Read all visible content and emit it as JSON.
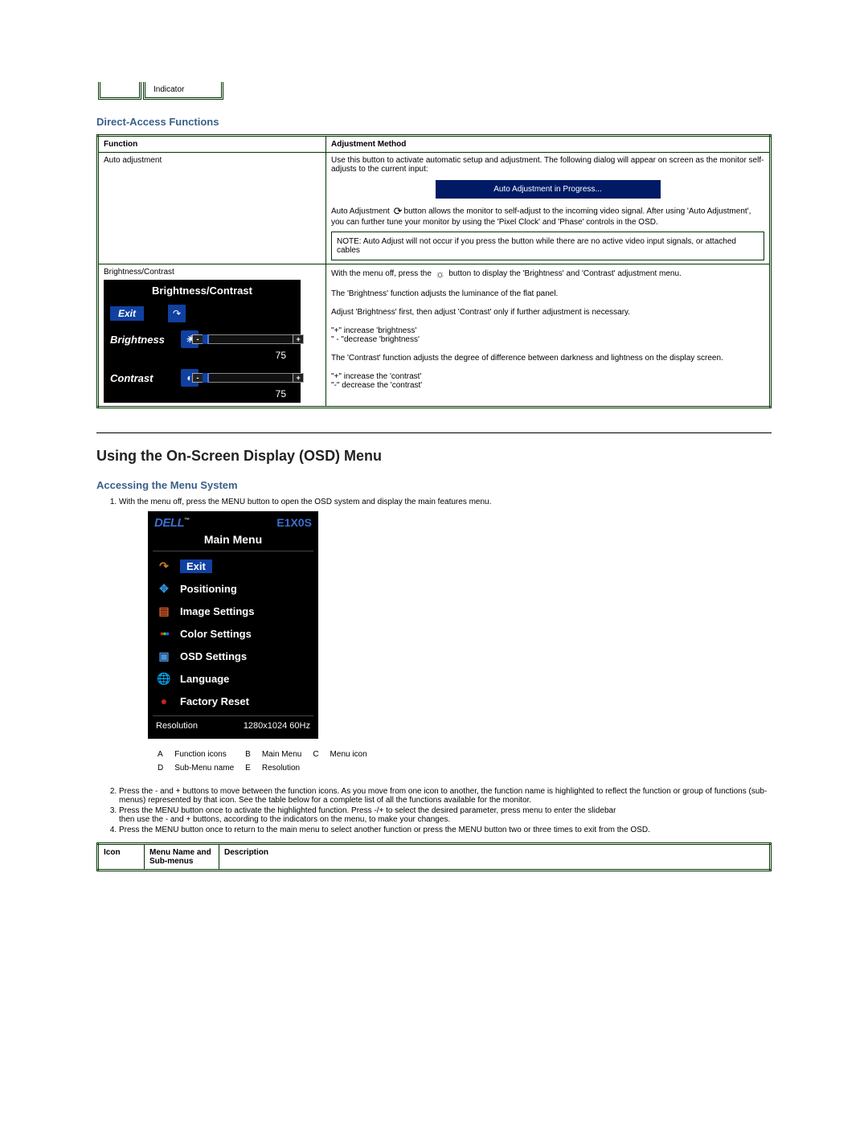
{
  "top_stub": {
    "label": "Indicator"
  },
  "section_direct_access": "Direct-Access Functions",
  "da_table": {
    "head_function": "Function",
    "head_method": "Adjustment Method",
    "row_auto": {
      "name": "Auto adjustment",
      "intro": "Use this button to activate automatic setup and adjustment. The following dialog will appear on screen as the monitor self-adjusts to the current input:",
      "progress_box": "Auto Adjustment in Progress...",
      "body1_a": "Auto Adjustment ",
      "body1_b": "button allows the monitor to self-adjust to the incoming video signal. After using 'Auto Adjustment', you can further tune your monitor by using the 'Pixel Clock' and 'Phase' controls in the OSD.",
      "note": "NOTE: Auto Adjust will not occur if you press the button while there are no active video input signals, or attached cables"
    },
    "row_bc": {
      "name": "Brightness/Contrast",
      "osd": {
        "title": "Brightness/Contrast",
        "exit": "Exit",
        "brightness_label": "Brightness",
        "brightness_value": "75",
        "contrast_label": "Contrast",
        "contrast_value": "75"
      },
      "r1a": "With the menu off, press the ",
      "r1b": " button to display the 'Brightness' and 'Contrast' adjustment menu.",
      "r2": "The 'Brightness' function adjusts the luminance of the flat panel.",
      "r3": "Adjust 'Brightness' first, then adjust 'Contrast' only if further adjustment is necessary.",
      "r4a": "\"+\" increase 'brightness'",
      "r4b": "\" - \"decrease 'brightness'",
      "r5": "The 'Contrast' function adjusts the degree of difference between darkness and lightness on the display screen.",
      "r6a": "\"+\" increase the 'contrast'",
      "r6b": "\"-\" decrease the 'contrast'"
    }
  },
  "section_osd_heading": "Using the On-Screen Display (OSD) Menu",
  "section_accessing": "Accessing the Menu System",
  "step1": "With the menu off, press the MENU button to open the OSD system and display the main features menu.",
  "main_menu": {
    "logo_text": "DELL",
    "model": "E1X0S",
    "title": "Main Menu",
    "items": [
      {
        "label": "Exit",
        "icon": "exit-icon",
        "selected": true
      },
      {
        "label": "Positioning",
        "icon": "positioning-icon"
      },
      {
        "label": "Image Settings",
        "icon": "image-settings-icon"
      },
      {
        "label": "Color Settings",
        "icon": "color-settings-icon"
      },
      {
        "label": "OSD Settings",
        "icon": "osd-settings-icon"
      },
      {
        "label": "Language",
        "icon": "language-icon"
      },
      {
        "label": "Factory Reset",
        "icon": "factory-reset-icon"
      }
    ],
    "footer_label": "Resolution",
    "footer_value": "1280x1024 60Hz"
  },
  "key_legend": {
    "A": "Function icons",
    "B": "Main Menu",
    "C": "Menu icon",
    "D": "Sub-Menu name",
    "E": "Resolution"
  },
  "step2": "Press the - and + buttons to move between the function icons. As you move from one icon to another, the function name is highlighted to reflect the function or group of functions (sub-menus) represented by that icon. See the table below for a complete list of all the functions available for the monitor.",
  "step3": "Press the MENU button once to activate the highlighted function. Press -/+ to select the desired parameter, press menu to enter the slidebar\nthen use the - and + buttons, according to the indicators on the menu, to make your changes.",
  "step4": "Press the MENU button once to return to the main menu to select another function or press the MENU button two or three times to exit from the OSD.",
  "desc_table": {
    "h_icon": "Icon",
    "h_menu": "Menu Name and Sub-menus",
    "h_desc": "Description"
  }
}
